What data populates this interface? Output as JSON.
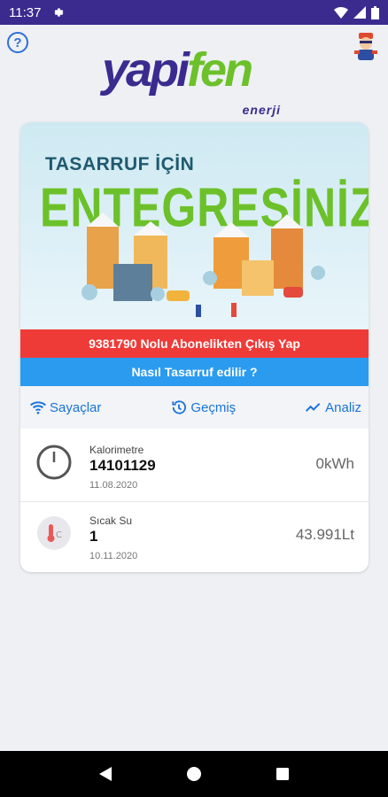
{
  "status_bar": {
    "time": "11:37"
  },
  "logo": {
    "main_left": "yapi",
    "main_right": "fen",
    "sub": "enerji"
  },
  "banner": {
    "line1": "TASARRUF İÇİN",
    "line2": "ENTEGRESİNİZ!"
  },
  "buttons": {
    "exit": "9381790 Nolu Abonelikten Çıkış Yap",
    "how_to_save": "Nasıl Tasarruf edilir ?"
  },
  "tabs": [
    {
      "label": "Sayaçlar",
      "icon": "wifi-icon"
    },
    {
      "label": "Geçmiş",
      "icon": "history-icon"
    },
    {
      "label": "Analiz",
      "icon": "trend-icon"
    }
  ],
  "meters": [
    {
      "type": "Kalorimetre",
      "number": "14101129",
      "date": "11.08.2020",
      "reading": "0kWh",
      "icon": "gauge-icon"
    },
    {
      "type": "Sıcak Su",
      "number": "1",
      "date": "10.11.2020",
      "reading": "43.991Lt",
      "icon": "thermometer-icon"
    }
  ],
  "colors": {
    "status_bar": "#3b2b8f",
    "brand_purple": "#3b2b8f",
    "brand_green": "#6cc12a",
    "exit_red": "#ef3b38",
    "info_blue": "#2b9bf0",
    "tab_blue": "#1a73d9"
  }
}
